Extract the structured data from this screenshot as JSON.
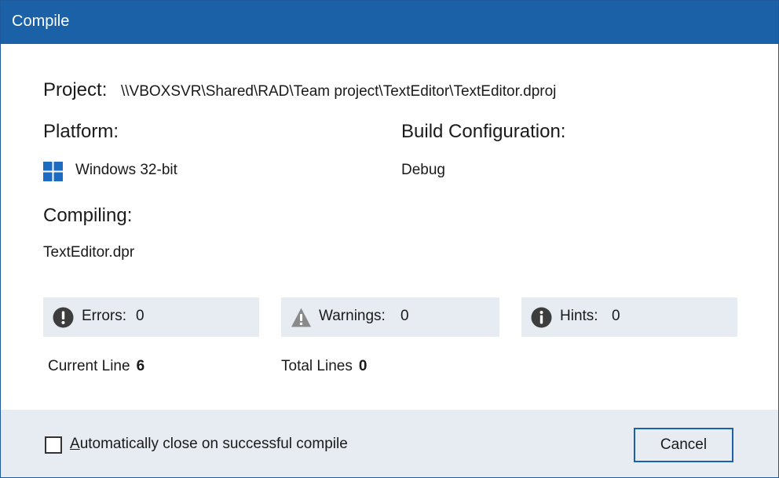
{
  "window": {
    "title": "Compile"
  },
  "project": {
    "label": "Project:",
    "path": "\\\\VBOXSVR\\Shared\\RAD\\Team project\\TextEditor\\TextEditor.dproj"
  },
  "platform": {
    "label": "Platform:",
    "value": "Windows 32-bit",
    "icon": "windows-logo-icon"
  },
  "build_configuration": {
    "label": "Build Configuration:",
    "value": "Debug"
  },
  "compiling": {
    "label": "Compiling:",
    "file": "TextEditor.dpr"
  },
  "stats": {
    "errors": {
      "label": "Errors:",
      "value": "0",
      "icon": "error-icon"
    },
    "warnings": {
      "label": "Warnings:",
      "value": "0",
      "icon": "warning-icon"
    },
    "hints": {
      "label": "Hints:",
      "value": "0",
      "icon": "info-icon"
    }
  },
  "lines": {
    "current_label": "Current Line",
    "current_value": "6",
    "total_label": "Total Lines",
    "total_value": "0"
  },
  "footer": {
    "auto_close_accel": "A",
    "auto_close_rest": "utomatically close on successful compile",
    "auto_close_checked": false,
    "cancel_label": "Cancel"
  },
  "colors": {
    "titlebar": "#1b61a8",
    "panel": "#e6ecf2",
    "accent": "#1b61a8",
    "windows_logo": "#1c6cc1"
  }
}
